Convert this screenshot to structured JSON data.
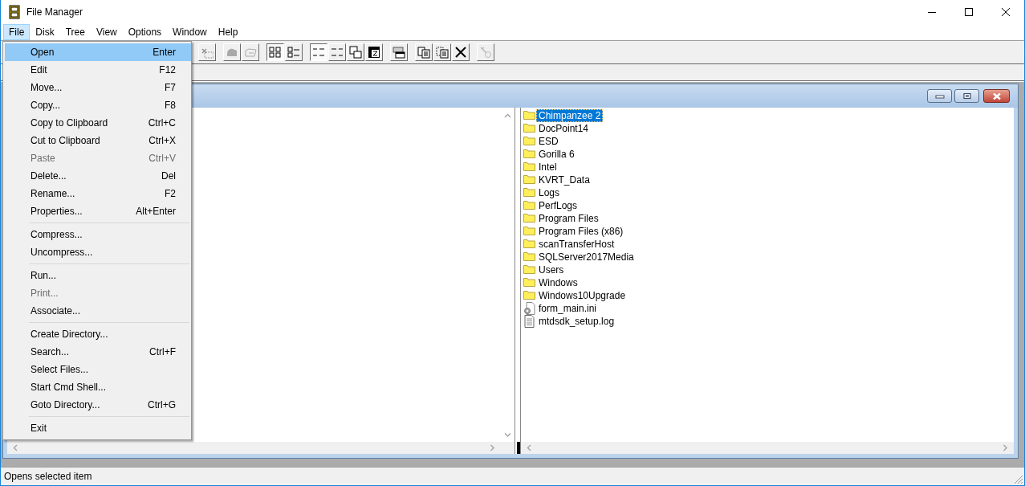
{
  "window": {
    "title": "File Manager"
  },
  "menubar": [
    {
      "label": "File",
      "selected": true
    },
    {
      "label": "Disk",
      "selected": false
    },
    {
      "label": "Tree",
      "selected": false
    },
    {
      "label": "View",
      "selected": false
    },
    {
      "label": "Options",
      "selected": false
    },
    {
      "label": "Window",
      "selected": false
    },
    {
      "label": "Help",
      "selected": false
    }
  ],
  "toolbar": [
    {
      "buttons": [
        {
          "kind": "disconnect-drive",
          "pressed": false,
          "disabled": true
        }
      ]
    },
    {
      "buttons": [
        {
          "kind": "share",
          "pressed": false,
          "disabled": true
        },
        {
          "kind": "stop-share",
          "pressed": false,
          "disabled": true
        }
      ]
    },
    {
      "buttons": [
        {
          "kind": "large-icons",
          "pressed": true,
          "disabled": false
        },
        {
          "kind": "list",
          "pressed": false,
          "disabled": false
        }
      ]
    },
    {
      "buttons": [
        {
          "kind": "sort-name",
          "pressed": true,
          "disabled": false
        },
        {
          "kind": "sort-type",
          "pressed": false,
          "disabled": false
        },
        {
          "kind": "new-window",
          "pressed": false,
          "disabled": false
        },
        {
          "kind": "zip",
          "pressed": false,
          "disabled": false
        }
      ]
    },
    {
      "buttons": [
        {
          "kind": "cascade",
          "pressed": false,
          "disabled": false
        }
      ]
    },
    {
      "buttons": [
        {
          "kind": "copy",
          "pressed": false,
          "disabled": false
        },
        {
          "kind": "move",
          "pressed": false,
          "disabled": false
        },
        {
          "kind": "delete",
          "pressed": false,
          "disabled": false
        }
      ]
    },
    {
      "buttons": [
        {
          "kind": "key",
          "pressed": false,
          "disabled": true
        }
      ]
    }
  ],
  "file_menu": [
    {
      "kind": "item",
      "label": "Open",
      "shortcut": "Enter",
      "selected": true,
      "disabled": false
    },
    {
      "kind": "item",
      "label": "Edit",
      "shortcut": "F12",
      "selected": false,
      "disabled": false
    },
    {
      "kind": "item",
      "label": "Move...",
      "shortcut": "F7",
      "selected": false,
      "disabled": false
    },
    {
      "kind": "item",
      "label": "Copy...",
      "shortcut": "F8",
      "selected": false,
      "disabled": false
    },
    {
      "kind": "item",
      "label": "Copy to Clipboard",
      "shortcut": "Ctrl+C",
      "selected": false,
      "disabled": false
    },
    {
      "kind": "item",
      "label": "Cut to Clipboard",
      "shortcut": "Ctrl+X",
      "selected": false,
      "disabled": false
    },
    {
      "kind": "item",
      "label": "Paste",
      "shortcut": "Ctrl+V",
      "selected": false,
      "disabled": true
    },
    {
      "kind": "item",
      "label": "Delete...",
      "shortcut": "Del",
      "selected": false,
      "disabled": false
    },
    {
      "kind": "item",
      "label": "Rename...",
      "shortcut": "F2",
      "selected": false,
      "disabled": false
    },
    {
      "kind": "item",
      "label": "Properties...",
      "shortcut": "Alt+Enter",
      "selected": false,
      "disabled": false
    },
    {
      "kind": "separator"
    },
    {
      "kind": "item",
      "label": "Compress...",
      "selected": false,
      "disabled": false
    },
    {
      "kind": "item",
      "label": "Uncompress...",
      "selected": false,
      "disabled": false
    },
    {
      "kind": "separator"
    },
    {
      "kind": "item",
      "label": "Run...",
      "selected": false,
      "disabled": false
    },
    {
      "kind": "item",
      "label": "Print...",
      "selected": false,
      "disabled": true
    },
    {
      "kind": "item",
      "label": "Associate...",
      "selected": false,
      "disabled": false
    },
    {
      "kind": "separator"
    },
    {
      "kind": "item",
      "label": "Create Directory...",
      "selected": false,
      "disabled": false
    },
    {
      "kind": "item",
      "label": "Search...",
      "shortcut": "Ctrl+F",
      "selected": false,
      "disabled": false
    },
    {
      "kind": "item",
      "label": "Select Files...",
      "selected": false,
      "disabled": false
    },
    {
      "kind": "item",
      "label": "Start Cmd Shell...",
      "selected": false,
      "disabled": false
    },
    {
      "kind": "item",
      "label": "Goto Directory...",
      "shortcut": "Ctrl+G",
      "selected": false,
      "disabled": false
    },
    {
      "kind": "separator"
    },
    {
      "kind": "item",
      "label": "Exit",
      "selected": false,
      "disabled": false
    }
  ],
  "directory_window": {
    "files": [
      {
        "kind": "folder",
        "name": "Chimpanzee 2",
        "selected": true
      },
      {
        "kind": "folder",
        "name": "DocPoint14",
        "selected": false
      },
      {
        "kind": "folder",
        "name": "ESD",
        "selected": false
      },
      {
        "kind": "folder",
        "name": "Gorilla 6",
        "selected": false
      },
      {
        "kind": "folder",
        "name": "Intel",
        "selected": false
      },
      {
        "kind": "folder",
        "name": "KVRT_Data",
        "selected": false
      },
      {
        "kind": "folder",
        "name": "Logs",
        "selected": false
      },
      {
        "kind": "folder",
        "name": "PerfLogs",
        "selected": false
      },
      {
        "kind": "folder",
        "name": "Program Files",
        "selected": false
      },
      {
        "kind": "folder",
        "name": "Program Files (x86)",
        "selected": false
      },
      {
        "kind": "folder",
        "name": "scanTransferHost",
        "selected": false
      },
      {
        "kind": "folder",
        "name": "SQLServer2017Media",
        "selected": false
      },
      {
        "kind": "folder",
        "name": "Users",
        "selected": false
      },
      {
        "kind": "folder",
        "name": "Windows",
        "selected": false
      },
      {
        "kind": "folder",
        "name": "Windows10Upgrade",
        "selected": false
      },
      {
        "kind": "settings-file",
        "name": "form_main.ini",
        "selected": false
      },
      {
        "kind": "text-file",
        "name": "mtdsdk_setup.log",
        "selected": false
      }
    ]
  },
  "status_bar": {
    "text": "Opens selected item"
  }
}
